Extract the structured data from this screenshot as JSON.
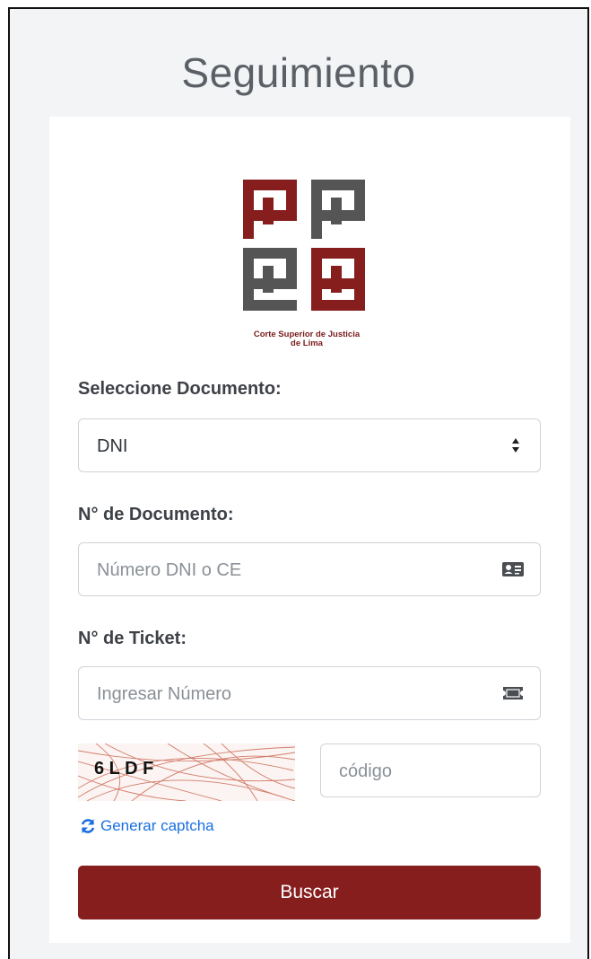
{
  "page": {
    "title": "Seguimiento"
  },
  "logo": {
    "line1": "Corte Superior de Justicia",
    "line2": "de Lima"
  },
  "form": {
    "document_type_label": "Seleccione Documento:",
    "document_type_value": "DNI",
    "document_number_label": "N° de Documento:",
    "document_number_placeholder": "Número DNI o CE",
    "ticket_label": "N° de Ticket:",
    "ticket_placeholder": "Ingresar Número",
    "captcha_text": "6 L D F",
    "captcha_code_placeholder": "código",
    "regenerate_label": "Generar captcha",
    "search_button": "Buscar"
  },
  "colors": {
    "brand": "#861e1e",
    "logo_gray": "#555555",
    "link": "#1a6fe0"
  }
}
